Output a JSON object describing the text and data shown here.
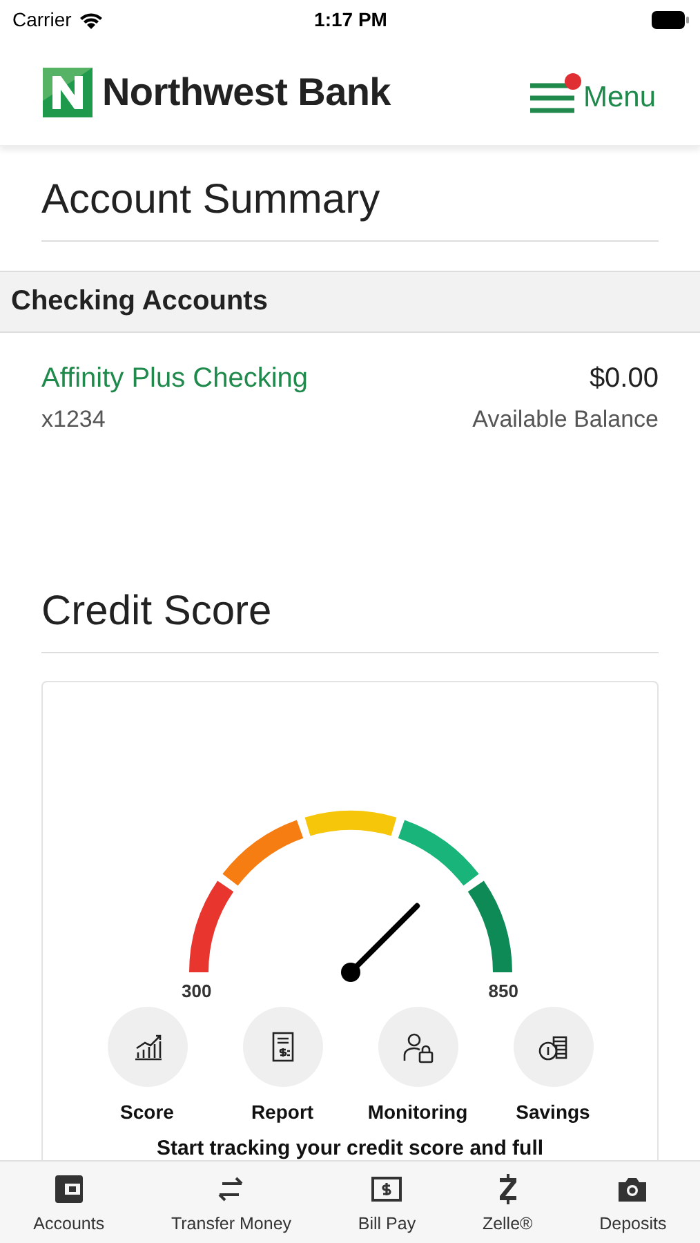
{
  "status_bar": {
    "carrier": "Carrier",
    "time": "1:17 PM"
  },
  "header": {
    "brand": "Northwest Bank",
    "menu_label": "Menu",
    "menu_notification": true
  },
  "account_summary": {
    "title": "Account Summary",
    "section": "Checking Accounts",
    "accounts": [
      {
        "name": "Affinity Plus Checking",
        "number": "x1234",
        "balance": "$0.00",
        "balance_label": "Available Balance"
      }
    ]
  },
  "credit_score": {
    "title": "Credit Score",
    "gauge": {
      "min_label": "300",
      "max_label": "850"
    },
    "actions": [
      {
        "kind": "score",
        "label": "Score"
      },
      {
        "kind": "report",
        "label": "Report"
      },
      {
        "kind": "monitoring",
        "label": "Monitoring"
      },
      {
        "kind": "savings",
        "label": "Savings"
      }
    ],
    "teaser": "Start tracking your credit score and full"
  },
  "tab_bar": [
    {
      "kind": "accounts",
      "label": "Accounts"
    },
    {
      "kind": "transfer",
      "label": "Transfer Money"
    },
    {
      "kind": "billpay",
      "label": "Bill Pay"
    },
    {
      "kind": "zelle",
      "label": "Zelle®"
    },
    {
      "kind": "deposits",
      "label": "Deposits"
    }
  ]
}
